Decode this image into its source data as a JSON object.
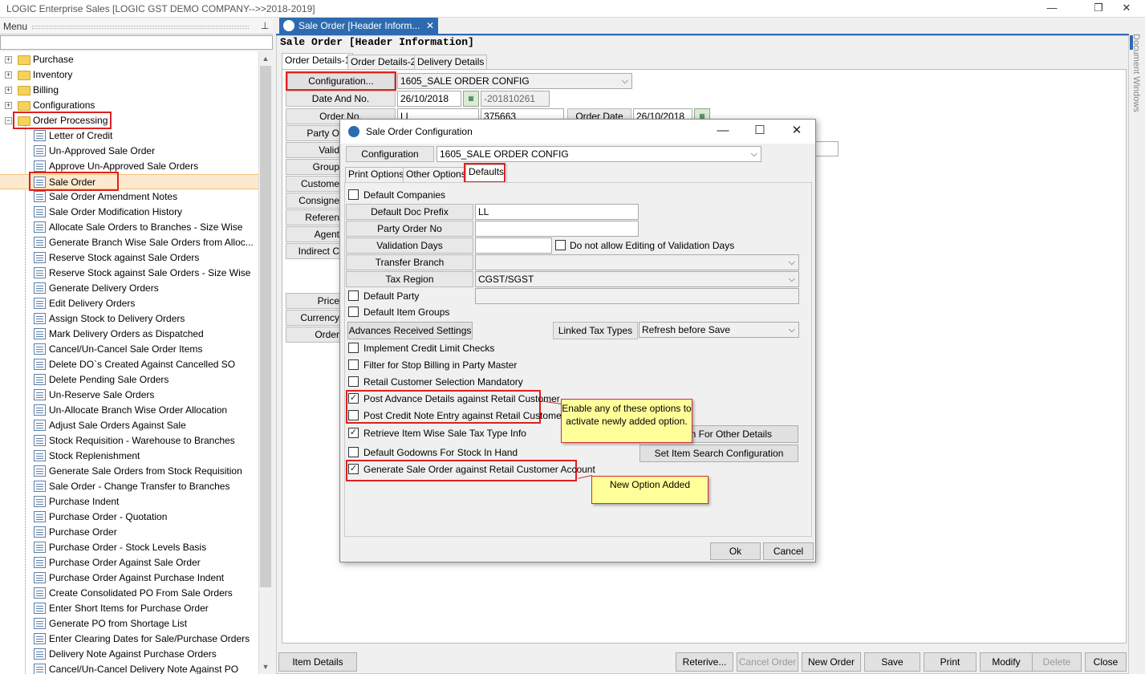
{
  "app": {
    "title": "LOGIC Enterprise Sales  [LOGIC GST DEMO COMPANY-->>2018-2019]",
    "window_minimize": "—",
    "window_restore": "❐",
    "window_close": "✕"
  },
  "menu": {
    "header": "Menu",
    "pin_icon": "📌",
    "top_folders": [
      "Purchase",
      "Inventory",
      "Billing",
      "Configurations",
      "Order Processing"
    ],
    "items": [
      "Letter of Credit",
      "Un-Approved Sale Order",
      "Approve Un-Approved Sale Orders",
      "Sale Order",
      "Sale Order Amendment Notes",
      "Sale Order Modification History",
      "Allocate Sale Orders to Branches - Size Wise",
      "Generate Branch Wise Sale Orders from Alloc...",
      "Reserve Stock against Sale Orders",
      "Reserve Stock against Sale Orders - Size Wise",
      "Generate Delivery Orders",
      "Edit Delivery Orders",
      "Assign Stock to Delivery Orders",
      "Mark Delivery Orders as Dispatched",
      "Cancel/Un-Cancel Sale Order Items",
      "Delete DO`s Created Against Cancelled SO",
      "Delete Pending Sale Orders",
      "Un-Reserve Sale Orders",
      "Un-Allocate Branch Wise Order Allocation",
      "Adjust Sale Orders Against Sale",
      "Stock Requisition - Warehouse to Branches",
      "Stock Replenishment",
      "Generate Sale Orders from Stock Requisition",
      "Sale Order - Change Transfer to Branches",
      "Purchase Indent",
      "Purchase Order - Quotation",
      "Purchase Order",
      "Purchase Order - Stock Levels Basis",
      "Purchase Order Against Sale Order",
      "Purchase Order Against Purchase Indent",
      "Create Consolidated PO From Sale Orders",
      "Enter Short Items for Purchase Order",
      "Generate PO from Shortage List",
      "Enter Clearing Dates for Sale/Purchase Orders",
      "Delivery Note Against Purchase Orders",
      "Cancel/Un-Cancel Delivery Note Against PO"
    ]
  },
  "doc_tab": {
    "label": "Sale Order [Header Inform...",
    "close": "✕"
  },
  "form": {
    "title": "Sale Order [Header Information]",
    "tabs": [
      "Order Details-1",
      "Order Details-2",
      "Delivery Details"
    ],
    "configuration_btn": "Configuration...",
    "configuration_value": "1605_SALE ORDER CONFIG",
    "date_and_no_label": "Date And No.",
    "date_value": "26/10/2018",
    "doc_no_value": "-201810261",
    "order_no_label": "Order No.",
    "order_no_prefix": "LL",
    "order_no_value": "375663",
    "order_date_label": "Order Date",
    "order_date_value": "26/10/2018",
    "side_labels": [
      "Party O",
      "Valid",
      "Group",
      "Custome",
      "Consigne",
      "Referen",
      "Agent",
      "Indirect C",
      "Price",
      "Currency",
      "Order"
    ]
  },
  "bottom_buttons": {
    "item_details": "Item Details",
    "retrieve": "Reterive...",
    "cancel_order": "Cancel Order",
    "new_order": "New Order",
    "save": "Save",
    "print": "Print",
    "modify": "Modify",
    "delete": "Delete",
    "close": "Close"
  },
  "dialog": {
    "title": "Sale Order Configuration",
    "configuration_label": "Configuration",
    "configuration_value": "1605_SALE ORDER CONFIG",
    "tabs": [
      "Print Options",
      "Other Options",
      "Defaults"
    ],
    "default_companies": "Default Companies",
    "default_doc_prefix_label": "Default Doc Prefix",
    "default_doc_prefix_value": "LL",
    "party_order_no_label": "Party Order No",
    "party_order_no_value": "",
    "validation_days_label": "Validation Days",
    "validation_days_value": "",
    "no_edit_validation": "Do not allow Editing of Validation Days",
    "transfer_branch_label": "Transfer Branch",
    "transfer_branch_value": "",
    "tax_region_label": "Tax Region",
    "tax_region_value": "CGST/SGST",
    "default_party": "Default Party",
    "default_item_groups": "Default Item Groups",
    "advances_btn": "Advances Received Settings",
    "linked_tax_types_label": "Linked Tax Types",
    "linked_tax_types_value": "Refresh before Save",
    "implement_credit": "Implement Credit Limit Checks",
    "filter_stop_billing": "Filter for Stop Billing in Party Master",
    "retail_customer_mandatory": "Retail Customer Selection Mandatory",
    "post_advance": "Post Advance Details against Retail Customer",
    "post_credit_note": "Post Credit Note Entry against Retail Customer",
    "retrieve_tax_type": "Retrieve Item Wise Sale Tax Type Info",
    "default_godowns": "Default Godowns For Stock In Hand",
    "generate_so_retail": "Generate Sale Order against Retail Customer Account",
    "permission_btn": "sion For Other Details",
    "item_search_btn": "Set Item Search Configuration",
    "ok": "Ok",
    "cancel": "Cancel",
    "checked": {
      "post_advance": true,
      "retrieve_tax_type": true,
      "generate_so_retail": true
    }
  },
  "callouts": {
    "enable_options": "Enable any of these options to activate newly added option.",
    "new_option": "New Option Added"
  },
  "right_sidebar": {
    "label": "Document Windows"
  },
  "colors": {
    "accent": "#2d6bb1",
    "highlight": "#e02020",
    "callout": "#ffff99"
  }
}
